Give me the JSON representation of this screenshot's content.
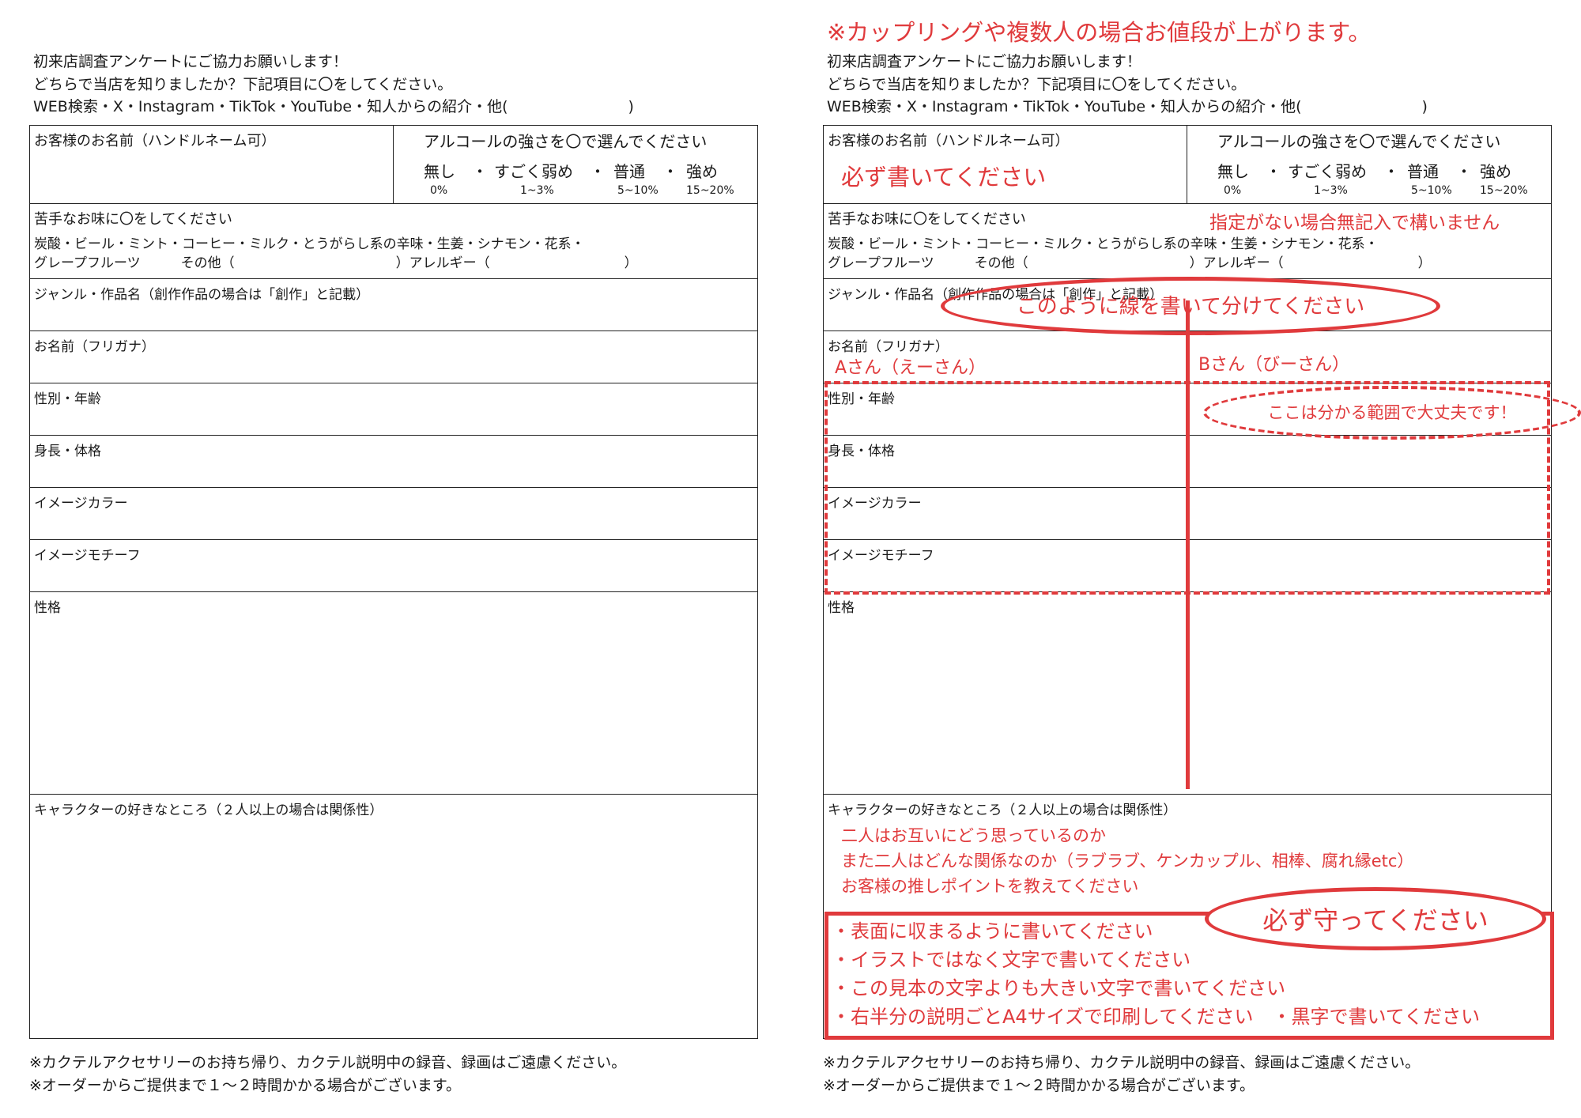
{
  "accent_color": "#e03a3c",
  "form": {
    "intro": [
      "初来店調査アンケートにご協力お願いします！",
      "どちらで当店を知りましたか？下記項目に〇をしてください。",
      "WEB検索・X・Instagram・TikTok・YouTube・知人からの紹介・他(　　　　　　　　)"
    ],
    "name_label": "お客様のお名前（ハンドルネーム可）",
    "alcohol": {
      "title": "アルコールの強さを〇で選んでください",
      "options": [
        {
          "label": "無し",
          "range": "0%"
        },
        {
          "label": "すごく弱め",
          "range": "1~3%"
        },
        {
          "label": "普通",
          "range": "5~10%"
        },
        {
          "label": "強め",
          "range": "15~20%"
        }
      ],
      "separator": "・"
    },
    "dislike": {
      "title": "苦手なお味に〇をしてください",
      "line1": "炭酸・ビール・ミント・コーヒー・ミルク・とうがらし系の辛味・生姜・シナモン・花系・",
      "line2": "グレープフルーツ　　　その他（　　　　　　　　　　　　）アレルギー（　　　　　　　　　　）"
    },
    "genre_label": "ジャンル・作品名（創作作品の場合は「創作」と記載）",
    "furigana_label": "お名前（フリガナ）",
    "gender_label": "性別・年齢",
    "size_label": "身長・体格",
    "color_label": "イメージカラー",
    "motif_label": "イメージモチーフ",
    "personality_label": "性格",
    "likes_label": "キャラクターの好きなところ（２人以上の場合は関係性）",
    "footnotes": [
      "※カクテルアクセサリーのお持ち帰り、カクテル説明中の録音、録画はご遠慮ください。",
      "※オーダーからご提供まで１～２時間かかる場合がございます。"
    ]
  },
  "annotations": {
    "top_note": "※カップリングや複数人の場合お値段が上がります。",
    "name_required": "必ず書いてください",
    "dislike_note": "指定がない場合無記入で構いません",
    "divide_note": "このように線を書いて分けてください",
    "person_a": "Aさん（えーさん）",
    "person_b": "Bさん（びーさん）",
    "range_note": "ここは分かる範囲で大丈夫です！",
    "relation_lines": [
      "二人はお互いにどう思っているのか",
      "また二人はどんな関係なのか（ラブラブ、ケンカップル、相棒、腐れ縁etc）",
      "お客様の推しポイントを教えてください"
    ],
    "rules_title": "必ず守ってください",
    "rules": [
      "・表面に収まるように書いてください",
      "・イラストではなく文字で書いてください",
      "・この見本の文字よりも大きい文字で書いてください",
      "・右半分の説明ごとA4サイズで印刷してください　・黒字で書いてください"
    ]
  }
}
